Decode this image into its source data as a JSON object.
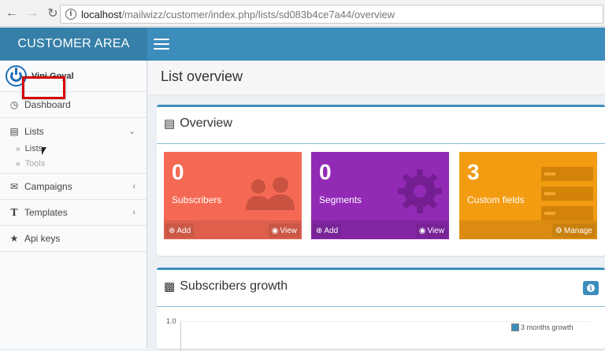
{
  "browser": {
    "url_host": "localhost",
    "url_path": "/mailwizz/customer/index.php/lists/sd083b4ce7a44/overview"
  },
  "header": {
    "logo": "CUSTOMER AREA"
  },
  "user": {
    "name": "Vini Goyal"
  },
  "sidebar": {
    "items": [
      {
        "label": "Dashboard",
        "icon": "dashboard-icon"
      },
      {
        "label": "Lists",
        "icon": "list-icon",
        "expanded": true,
        "children": [
          {
            "label": "Lists"
          },
          {
            "label": "Tools"
          }
        ]
      },
      {
        "label": "Campaigns",
        "icon": "envelope-icon"
      },
      {
        "label": "Templates",
        "icon": "text-icon"
      },
      {
        "label": "Api keys",
        "icon": "star-icon"
      }
    ]
  },
  "content": {
    "page_title": "List overview"
  },
  "overview": {
    "title": "Overview",
    "cards": [
      {
        "value": "0",
        "label": "Subscribers",
        "left_action": "Add",
        "right_action": "View",
        "color": "#f56954"
      },
      {
        "value": "0",
        "label": "Segments",
        "left_action": "Add",
        "right_action": "View",
        "color": "#932ab6"
      },
      {
        "value": "3",
        "label": "Custom fields",
        "right_action": "Manage",
        "color": "#f39c12"
      }
    ]
  },
  "growth": {
    "title": "Subscribers growth",
    "y_tick": "1.0",
    "legend": "3 months growth"
  }
}
